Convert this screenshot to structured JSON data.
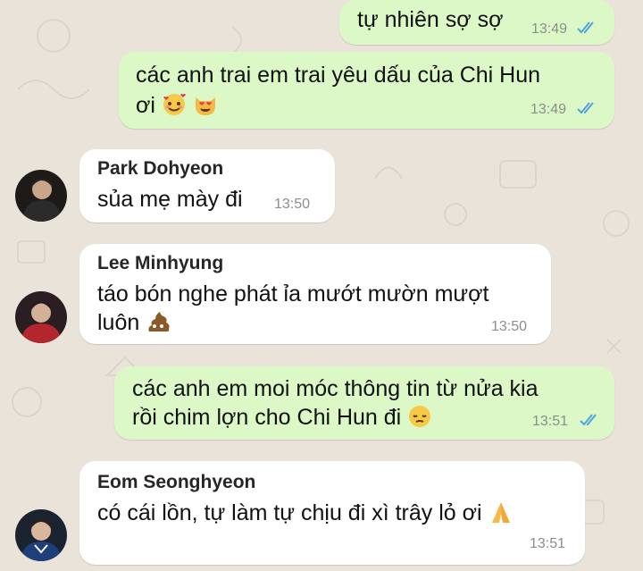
{
  "messages": [
    {
      "kind": "outgoing",
      "lines": [
        "tự nhiên sợ sợ"
      ],
      "time": "13:49",
      "status": "read-double-check-icon"
    },
    {
      "kind": "outgoing",
      "lines": [
        "các anh trai em trai yêu dấu của Chi Hun",
        "ơi"
      ],
      "emojis": [
        "smiling-face-with-hearts-emoji",
        "heart-eyes-cat-emoji"
      ],
      "time": "13:49",
      "status": "read-double-check-icon"
    },
    {
      "kind": "incoming",
      "sender": "Park Dohyeon",
      "lines": [
        "sủa mẹ mày đi"
      ],
      "time": "13:50",
      "avatar": "avatar-park-dohyeon"
    },
    {
      "kind": "incoming",
      "sender": "Lee Minhyung",
      "lines": [
        "táo bón nghe phát ỉa mướt mườn mượt",
        "luôn"
      ],
      "emojis": [
        "pile-of-poo-emoji"
      ],
      "time": "13:50",
      "avatar": "avatar-lee-minhyung"
    },
    {
      "kind": "outgoing",
      "lines": [
        "các anh em moi móc thông tin từ nửa kia",
        "rồi chim lợn cho Chi Hun đi"
      ],
      "emojis": [
        "pensive-face-emoji"
      ],
      "time": "13:51",
      "status": "read-double-check-icon"
    },
    {
      "kind": "incoming",
      "sender": "Eom Seonghyeon",
      "lines": [
        "có cái lồn, tự làm tự chịu đi xì trây lỏ ơi"
      ],
      "emojis": [
        "folded-hands-emoji"
      ],
      "time": "13:51",
      "avatar": "avatar-eom-seonghyeon"
    }
  ],
  "colors": {
    "outgoing_bubble": "#dcf8c6",
    "incoming_bubble": "#ffffff",
    "read_tick": "#4fa3e0",
    "wallpaper": "#e9e3da"
  }
}
